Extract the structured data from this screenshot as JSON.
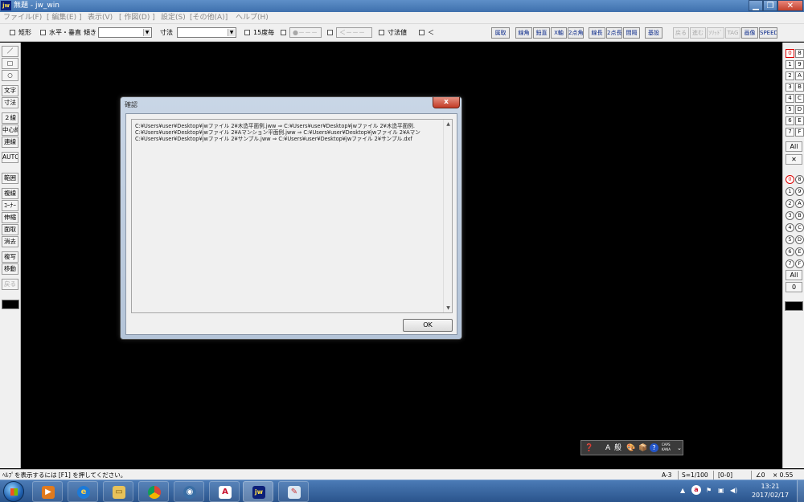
{
  "window": {
    "app_icon": "jw",
    "title": "無題 - jw_win",
    "buttons": {
      "minimize": "▁",
      "maximize": "❐",
      "close": "✕"
    }
  },
  "menubar": {
    "items": [
      "ファイル(F)",
      "[ 編集(E) ]",
      "表示(V)",
      "[ 作図(D) ]",
      "設定(S)",
      "[その他(A)]",
      "ヘルプ(H)"
    ]
  },
  "toolbar": {
    "rect_label": "矩形",
    "hv_label": "水平・垂直",
    "tilt_label": "傾き",
    "tilt_value": "",
    "dim_label": "寸法",
    "dim_value": "",
    "deg15_label": "15度毎",
    "circle_box": "●－－－",
    "arrow_box": "＜－－－",
    "dimval_label": "寸法値",
    "lt_label": "＜",
    "right_buttons": [
      "属取",
      "線角",
      "鉛直",
      "X軸",
      "2点角",
      "線長",
      "2点長",
      "間隔",
      "基設"
    ],
    "disabled_buttons": [
      "戻る",
      "進む",
      "ｿﾘｯﾄﾞ",
      "TAG"
    ],
    "end_buttons": [
      "画像",
      "SPEED"
    ]
  },
  "left_tools": [
    {
      "label": "／",
      "disabled": false
    },
    {
      "label": "□",
      "disabled": false
    },
    {
      "label": "○",
      "disabled": false
    },
    {
      "label": "文字",
      "disabled": false
    },
    {
      "label": "寸法",
      "disabled": false
    },
    {
      "label": "２線",
      "disabled": false
    },
    {
      "label": "中心線",
      "disabled": false
    },
    {
      "label": "連線",
      "disabled": false
    },
    {
      "label": "AUTO",
      "disabled": false
    },
    {
      "label": "範囲",
      "disabled": false
    },
    {
      "label": "複線",
      "disabled": false
    },
    {
      "label": "ｺｰﾅｰ",
      "disabled": false
    },
    {
      "label": "伸縮",
      "disabled": false
    },
    {
      "label": "面取",
      "disabled": false
    },
    {
      "label": "消去",
      "disabled": false
    },
    {
      "label": "複写",
      "disabled": false
    },
    {
      "label": "移動",
      "disabled": false
    },
    {
      "label": "戻る",
      "disabled": true
    }
  ],
  "right_tools": {
    "layer_keys": [
      "0",
      "8",
      "1",
      "9",
      "2",
      "A",
      "3",
      "B",
      "4",
      "C",
      "5",
      "D",
      "6",
      "E",
      "7",
      "F"
    ],
    "all_label": "All",
    "x_label": "✕",
    "group_keys": [
      "0",
      "8",
      "1",
      "9",
      "2",
      "A",
      "3",
      "B",
      "4",
      "C",
      "5",
      "D",
      "6",
      "E",
      "7",
      "F"
    ],
    "all2_label": "All",
    "zero_label": "0"
  },
  "dialog": {
    "title": "確認",
    "close": "x",
    "lines": [
      "C:¥Users¥user¥Desktop¥jwファイル 2¥木造平面例.jww ⇒ C:¥Users¥user¥Desktop¥jwファイル 2¥木造平面例.",
      "C:¥Users¥user¥Desktop¥jwファイル 2¥Aマンション平面例.jww ⇒ C:¥Users¥user¥Desktop¥jwファイル 2¥Aマン",
      "C:¥Users¥user¥Desktop¥jwファイル 2¥サンプル.jww ⇒ C:¥Users¥user¥Desktop¥jwファイル 2¥サンプル.dxf"
    ],
    "ok_label": "OK"
  },
  "imebar": {
    "items": [
      "❓",
      "A",
      "般",
      "🎨",
      "📦",
      "?",
      "CAPS KANA",
      "⌄"
    ]
  },
  "statusbar": {
    "help": "ﾍﾙﾌﾟを表示するには [F1] を押してください。",
    "paper": "A-3",
    "scale": "S=1/100",
    "layer": "[0-0]",
    "angle": "∠0",
    "factor": "× 0.55"
  },
  "taskbar": {
    "time": "13:21",
    "date": "2017/02/17"
  }
}
